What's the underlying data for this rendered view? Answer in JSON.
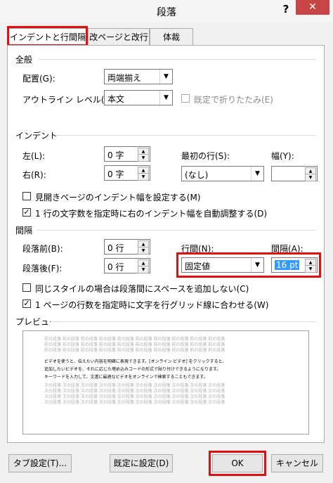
{
  "window": {
    "title": "段落",
    "help": "?",
    "close": "✕"
  },
  "tabs": [
    "インデントと行間隔",
    "改ページと改行",
    "体裁"
  ],
  "general": {
    "section": "全般",
    "alignment_label": "配置(G):",
    "alignment_value": "両端揃え",
    "outline_label": "アウトライン レベル(O):",
    "outline_value": "本文",
    "collapsed_label": "既定で折りたたみ(E)"
  },
  "indent": {
    "section": "インデント",
    "left_label": "左(L):",
    "left_value": "0 字",
    "right_label": "右(R):",
    "right_value": "0 字",
    "first_line_label": "最初の行(S):",
    "first_line_value": "(なし)",
    "width_label": "幅(Y):",
    "width_value": "",
    "mirror_label": "見開きページのインデント幅を設定する(M)",
    "auto_adjust_label": "1 行の文字数を指定時に右のインデント幅を自動調整する(D)"
  },
  "spacing": {
    "section": "間隔",
    "before_label": "段落前(B):",
    "before_value": "0 行",
    "after_label": "段落後(F):",
    "after_value": "0 行",
    "line_spacing_label": "行間(N):",
    "line_spacing_value": "固定値",
    "at_label": "間隔(A):",
    "at_value": "16 pt",
    "no_space_same_style_label": "同じスタイルの場合は段落間にスペースを追加しない(C)",
    "snap_grid_label": "1 ページの行数を指定時に文字を行グリッド線に合わせる(W)"
  },
  "preview": {
    "section": "プレビュー",
    "before_text": "前の段落 前の段落 前の段落 前の段落 前の段落 前の段落 前の段落 前の段落 前の段落 前の段落",
    "sample_lines": [
      "ビデオを使うと、伝えたい内容を明確に表現できます。[オンライン ビデオ] をクリックすると、",
      "追加したいビデオを、それに応じた埋め込みコードの形式で貼り付けできるようになります。",
      "キーワードを入力して、文書に最適なビデオをオンラインで検索することもできます。"
    ],
    "after_text": "次の段落 次の段落 次の段落 次の段落 次の段落 次の段落 次の段落 次の段落 次の段落 次の段落"
  },
  "buttons": {
    "tabs": "タブ設定(T)...",
    "default": "既定に設定(D)",
    "ok": "OK",
    "cancel": "キャンセル"
  },
  "colors": {
    "highlight_border": "#e01010",
    "close_bg": "#c74545",
    "selected_text_bg": "#3399ff"
  }
}
